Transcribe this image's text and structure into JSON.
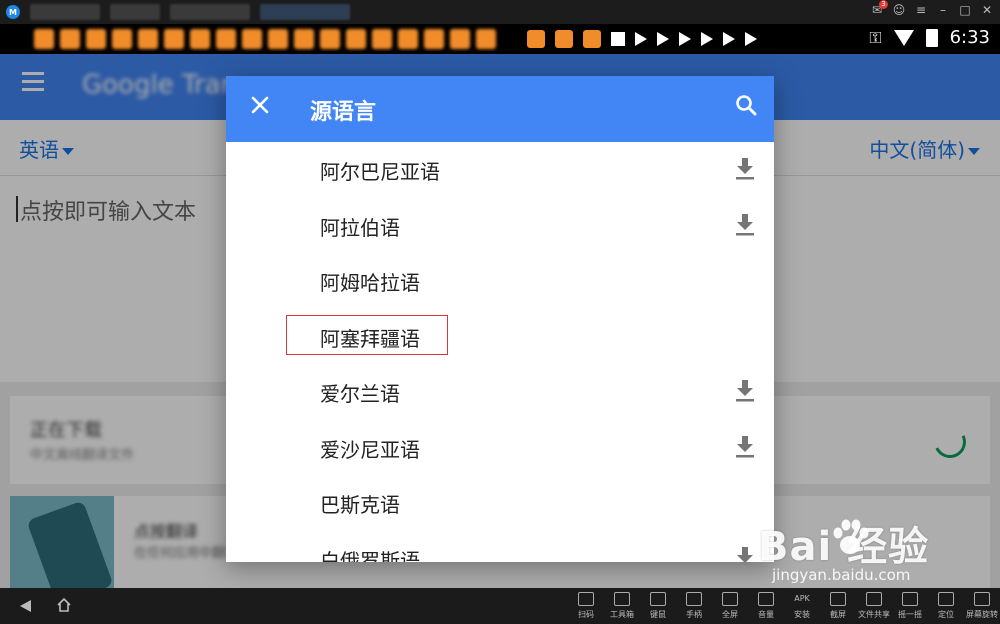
{
  "emulator": {
    "tabs": [
      "",
      "",
      "",
      ""
    ],
    "notification_badge": "3"
  },
  "statusbar": {
    "time": "6:33",
    "icons": [
      "key-icon",
      "wifi-icon",
      "battery-icon"
    ]
  },
  "app": {
    "title": "Google Tran",
    "source_language": "英语",
    "target_language": "中文(简体)",
    "input_placeholder": "点按即可输入文本"
  },
  "cards": {
    "download": {
      "title": "正在下载",
      "subtitle": "中文离线翻译文件"
    },
    "promo": {
      "title": "点按翻译",
      "subtitle": "在任何应用中翻译"
    }
  },
  "dialog": {
    "title": "源语言",
    "close_icon": "close-icon",
    "search_icon": "search-icon",
    "items": [
      {
        "label": "阿尔巴尼亚语",
        "downloadable": true
      },
      {
        "label": "阿拉伯语",
        "downloadable": true
      },
      {
        "label": "阿姆哈拉语",
        "downloadable": false
      },
      {
        "label": "阿塞拜疆语",
        "downloadable": false,
        "highlighted": true
      },
      {
        "label": "爱尔兰语",
        "downloadable": true
      },
      {
        "label": "爱沙尼亚语",
        "downloadable": true
      },
      {
        "label": "巴斯克语",
        "downloadable": false
      },
      {
        "label": "白俄罗斯语",
        "downloadable": true
      }
    ]
  },
  "navbar": {
    "tools": [
      "扫码",
      "工具箱",
      "键鼠",
      "手柄",
      "全屏",
      "音量",
      "安装",
      "截屏",
      "文件共享",
      "摇一摇",
      "定位",
      "屏幕旋转"
    ],
    "apk_label": "APK"
  },
  "watermark": {
    "brand": "Bai  经验",
    "url": "jingyan.baidu.com"
  },
  "colors": {
    "primary": "#4285f4",
    "link": "#1a73e8",
    "spinner": "#0f9d58",
    "highlight": "#d9363e"
  }
}
